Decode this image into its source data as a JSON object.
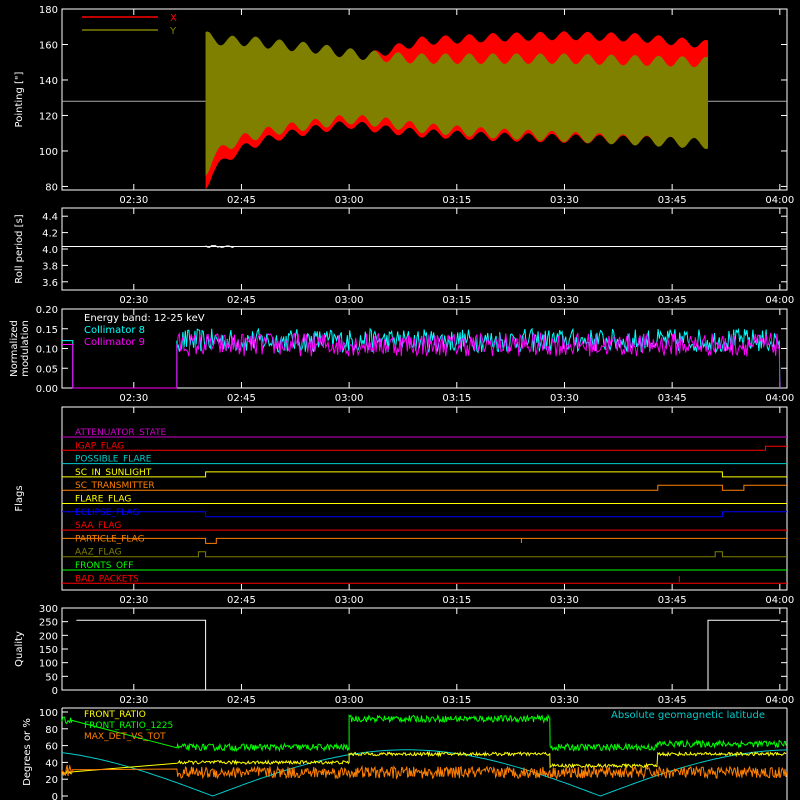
{
  "chart_data": [
    {
      "id": "pointing",
      "type": "area",
      "ylabel": "Pointing [\"]",
      "ylim": [
        78,
        180
      ],
      "yticks": [
        80,
        100,
        120,
        140,
        160,
        180
      ],
      "xticks": [
        "02:30",
        "02:45",
        "03:00",
        "03:15",
        "03:30",
        "03:45",
        "04:00"
      ],
      "reference_line": 128,
      "legend": [
        "X",
        "Y"
      ],
      "series": [
        {
          "name": "X",
          "color": "#ff0000",
          "x": [
            "02:40",
            "02:41",
            "02:43",
            "02:46",
            "02:50",
            "02:55",
            "03:00",
            "03:05",
            "03:10",
            "03:20",
            "03:30",
            "03:40",
            "03:50"
          ],
          "upper": [
            165,
            160,
            155,
            152,
            150,
            150,
            150,
            156,
            162,
            164,
            165,
            164,
            160
          ],
          "lower": [
            80,
            88,
            96,
            103,
            108,
            112,
            115,
            112,
            110,
            108,
            107,
            106,
            105
          ]
        },
        {
          "name": "Y",
          "color": "#808000",
          "x": [
            "02:40",
            "02:41",
            "02:43",
            "02:46",
            "02:50",
            "02:55",
            "03:00",
            "03:05",
            "03:10",
            "03:20",
            "03:30",
            "03:40",
            "03:50"
          ],
          "upper": [
            165,
            163,
            162,
            162,
            160,
            158,
            155,
            153,
            152,
            152,
            152,
            151,
            150
          ],
          "lower": [
            88,
            96,
            103,
            108,
            112,
            115,
            118,
            116,
            113,
            110,
            108,
            106,
            104
          ]
        }
      ]
    },
    {
      "id": "roll",
      "type": "line",
      "ylabel": "Roll period [s]",
      "ylim": [
        3.5,
        4.5
      ],
      "yticks": [
        "3.6",
        "3.8",
        "4.0",
        "4.2",
        "4.4"
      ],
      "xticks": [
        "02:30",
        "02:45",
        "03:00",
        "03:15",
        "03:30",
        "03:45",
        "04:00"
      ],
      "value": 4.03,
      "x_range": [
        "02:40",
        "02:44"
      ]
    },
    {
      "id": "modulation",
      "type": "line",
      "ylabel": "Normalized modulation",
      "ylim": [
        0,
        0.2
      ],
      "yticks": [
        "0.00",
        "0.05",
        "0.10",
        "0.15",
        "0.20"
      ],
      "xticks": [
        "02:30",
        "02:45",
        "03:00",
        "03:15",
        "03:30",
        "03:45",
        "04:00"
      ],
      "annotation": "Energy band: 12-25 keV",
      "series": [
        {
          "name": "Collimator 8",
          "color": "#00ffff",
          "mean": 0.12,
          "spread": 0.03,
          "start": "02:36",
          "end": "04:00"
        },
        {
          "name": "Collimator 9",
          "color": "#ff00ff",
          "mean": 0.11,
          "spread": 0.03,
          "start": "02:36",
          "end": "04:00"
        }
      ]
    },
    {
      "id": "flags",
      "type": "line",
      "ylabel": "Flags",
      "xticks": [
        "02:30",
        "02:45",
        "03:00",
        "03:15",
        "03:30",
        "03:45",
        "04:00"
      ],
      "series": [
        {
          "name": "ATTENUATOR_STATE",
          "color": "#cc00cc"
        },
        {
          "name": "IGAP_FLAG",
          "color": "#ff0000"
        },
        {
          "name": "POSSIBLE_FLARE",
          "color": "#00cccc"
        },
        {
          "name": "SC_IN_SUNLIGHT",
          "color": "#ffff00"
        },
        {
          "name": "SC_TRANSMITTER",
          "color": "#ff8000"
        },
        {
          "name": "FLARE_FLAG",
          "color": "#ffff00"
        },
        {
          "name": "ECLIPSE_FLAG",
          "color": "#0000ff"
        },
        {
          "name": "SAA_FLAG",
          "color": "#ff0000"
        },
        {
          "name": "PARTICLE_FLAG",
          "color": "#ff8000"
        },
        {
          "name": "AAZ_FLAG",
          "color": "#808000"
        },
        {
          "name": "FRONTS_OFF",
          "color": "#00ff00"
        },
        {
          "name": "BAD_PACKETS",
          "color": "#ff0000"
        }
      ]
    },
    {
      "id": "quality",
      "type": "line",
      "ylabel": "Quality",
      "ylim": [
        0,
        300
      ],
      "yticks": [
        "0",
        "50",
        "100",
        "150",
        "200",
        "250",
        "300"
      ],
      "xticks": [
        "02:30",
        "02:45",
        "03:00",
        "03:15",
        "03:30",
        "03:45",
        "04:00"
      ],
      "x": [
        "02:22",
        "02:40",
        "02:40",
        "03:50",
        "03:50",
        "04:00"
      ],
      "y": [
        255,
        255,
        0,
        0,
        255,
        255
      ]
    },
    {
      "id": "ratios",
      "type": "line",
      "ylabel": "Degrees or %",
      "ylim": [
        0,
        100
      ],
      "yticks": [
        "0",
        "20",
        "40",
        "60",
        "80",
        "100"
      ],
      "series": [
        {
          "name": "FRONT_RATIO",
          "color": "#ffff00"
        },
        {
          "name": "FRONT_RATIO_1225",
          "color": "#00ff00"
        },
        {
          "name": "MAX_DET_VS_TOT",
          "color": "#ff8000"
        },
        {
          "name": "Absolute geomagnetic latitude",
          "color": "#00cccc"
        }
      ]
    }
  ],
  "colors": {
    "axis": "#ffffff",
    "background": "#000000"
  }
}
